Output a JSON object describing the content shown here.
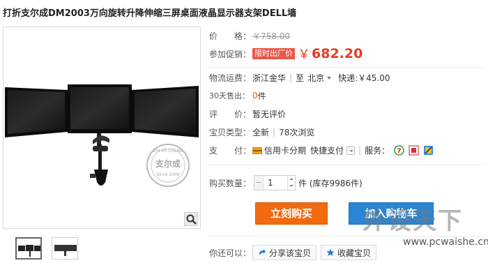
{
  "product": {
    "title": "打折支尔成DM2003万向旋转升降伸缩三屏桌面液晶显示器支架DELL墙"
  },
  "pricing": {
    "original_label": "价　　格：",
    "original_price": "￥758.00",
    "promo_label": "参加促销：",
    "promo_tag": "限时出厂价",
    "currency_symbol": "￥",
    "promo_price": "682.20"
  },
  "shipping": {
    "label": "物流运费：",
    "from": "浙江金华",
    "to_prefix": "至",
    "to_city": "北京",
    "express": "快递:￥45.00"
  },
  "sales": {
    "label": "30天售出：",
    "count": "0",
    "unit": "件"
  },
  "rating": {
    "label": "评　　价：",
    "value": "暂无评价"
  },
  "item_type": {
    "label": "宝贝类型：",
    "condition": "全新",
    "views": "78次浏览"
  },
  "payment": {
    "label": "支　　付：",
    "installment": "信用卡分期",
    "quick_pay": "快捷支付",
    "service_label": "服务："
  },
  "purchase": {
    "qty_label": "购买数量：",
    "qty_value": "1",
    "stock": "件 (库存9986件)",
    "buy_now": "立刻购买",
    "add_to_cart": "加入购物车"
  },
  "social": {
    "label": "你还可以：",
    "share": "分享该宝贝",
    "favorite": "收藏宝贝"
  },
  "gallery_stamp": {
    "brand_top": "ZHI ER CHENG",
    "brand_cn": "支尔成",
    "since": "Since 2006"
  },
  "watermark": {
    "logo_text": "外设天下",
    "url": "www.pcwaishe.cn"
  },
  "colors": {
    "price_red": "#e33b1f",
    "buy_orange": "#f26a10",
    "cart_blue": "#2a86d2",
    "promo_tag_bg": "#e8594a"
  }
}
